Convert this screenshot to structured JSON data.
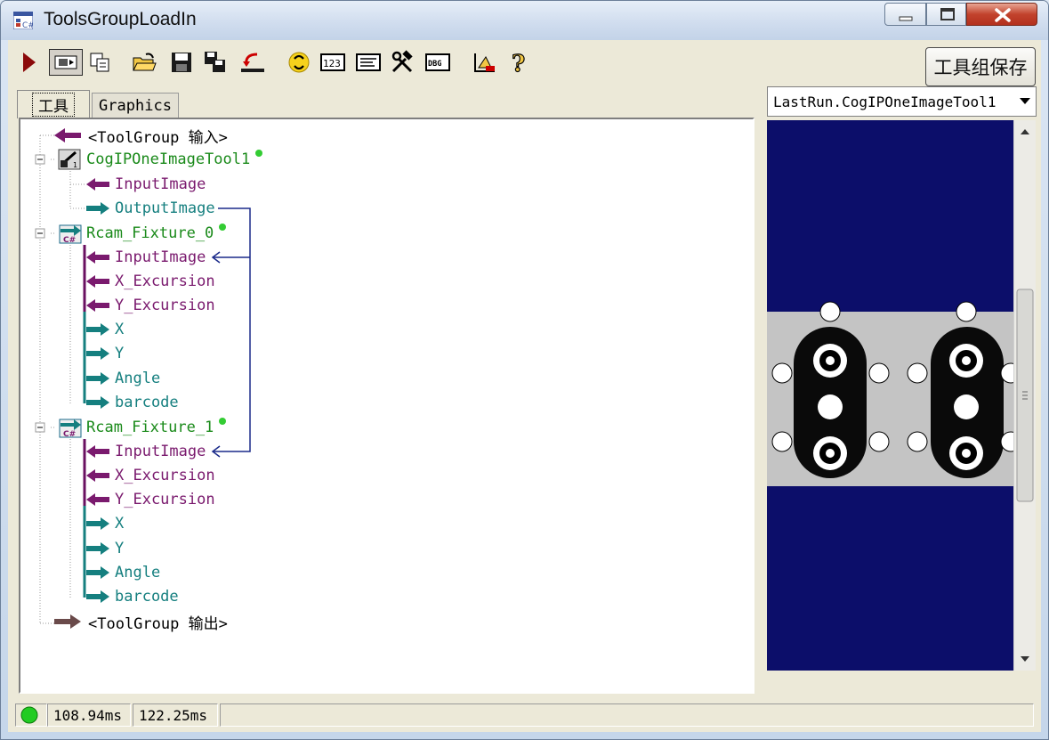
{
  "window": {
    "title": "ToolsGroupLoadIn"
  },
  "toolbar": {
    "save_label": "工具组保存",
    "icons": [
      "run-icon",
      "continuous-run-icon",
      "copy-icon",
      "open-folder-icon",
      "save-icon",
      "save-as-icon",
      "import-icon",
      "reset-icon",
      "counter-icon",
      "text-icon",
      "tools-icon",
      "debug-icon",
      "script-icon",
      "help-icon"
    ]
  },
  "tabs": {
    "tools": "工具",
    "graphics": "Graphics"
  },
  "tree": {
    "input_node": "<ToolGroup 输入>",
    "output_node": "<ToolGroup 输出>",
    "tool1": {
      "name": "CogIPOneImageTool1",
      "in1": "InputImage",
      "out1": "OutputImage"
    },
    "fixture0": {
      "name": "Rcam_Fixture_0",
      "in1": "InputImage",
      "in2": "X_Excursion",
      "in3": "Y_Excursion",
      "out1": "X",
      "out2": "Y",
      "out3": "Angle",
      "out4": "barcode"
    },
    "fixture1": {
      "name": "Rcam_Fixture_1",
      "in1": "InputImage",
      "in2": "X_Excursion",
      "in3": "Y_Excursion",
      "out1": "X",
      "out2": "Y",
      "out3": "Angle",
      "out4": "barcode"
    }
  },
  "display": {
    "selected_image": "LastRun.CogIPOneImageTool1"
  },
  "status": {
    "time1": "108.94ms",
    "time2": "122.25ms",
    "indicator_color": "#22cc22"
  },
  "colors": {
    "input_arrow": "#7a1a6e",
    "output_arrow": "#157f7f",
    "tool_status_dot": "#33cc33",
    "image_background": "#0c0e6a"
  }
}
